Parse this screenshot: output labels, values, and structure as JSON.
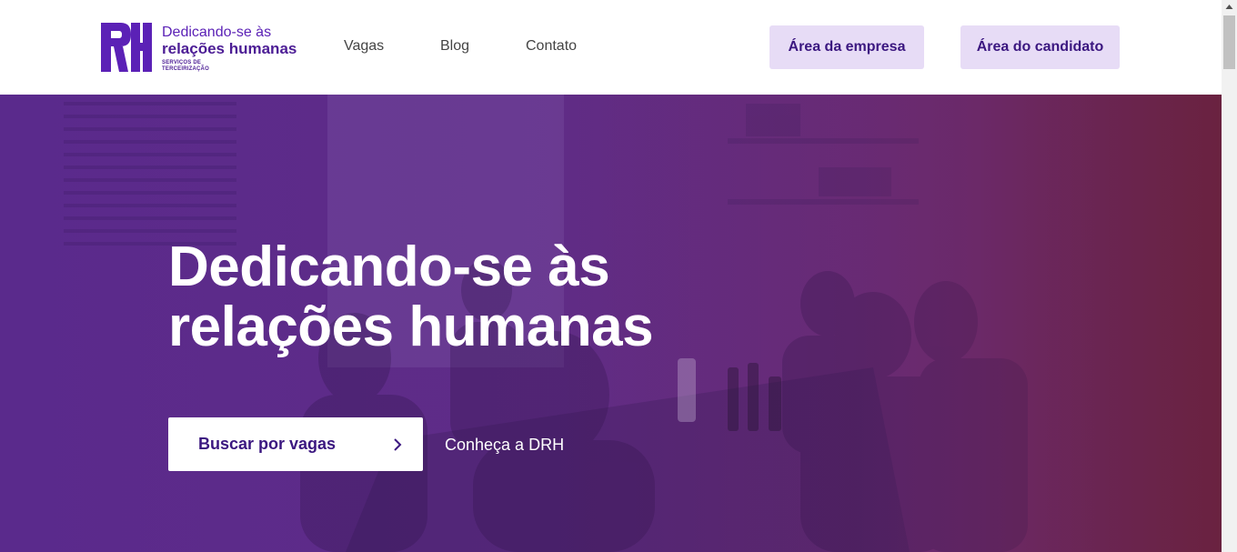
{
  "colors": {
    "brand": "#5b21b6",
    "brand_dark": "#3b1780",
    "button_bg": "#e7dcf6",
    "hero_overlay_start": "#5a2a8c",
    "hero_overlay_end": "#6a2240"
  },
  "logo": {
    "mark": "RH",
    "line1": "Dedicando-se às",
    "line2": "relações humanas",
    "line3a": "SERVIÇOS DE",
    "line3b": "TERCEIRIZAÇÃO"
  },
  "nav": {
    "items": [
      {
        "label": "Vagas"
      },
      {
        "label": "Blog"
      },
      {
        "label": "Contato"
      }
    ]
  },
  "header_buttons": {
    "empresa": "Área da empresa",
    "candidato": "Área do candidato"
  },
  "hero": {
    "title_line1": "Dedicando-se às",
    "title_line2": "relações humanas",
    "primary_cta": "Buscar por vagas",
    "primary_cta_icon": "chevron-right-icon",
    "secondary_cta": "Conheça a DRH",
    "background": "photo of people around a table with purple overlay"
  }
}
